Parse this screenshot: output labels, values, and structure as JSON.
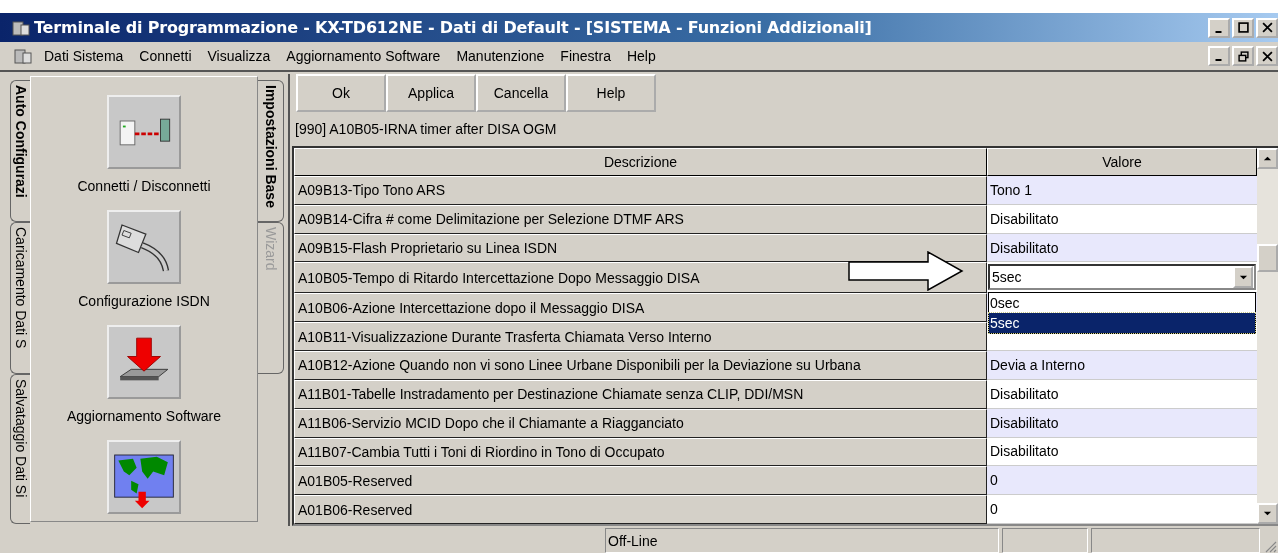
{
  "window": {
    "title": "Terminale di Programmazione - KX-TD612NE - Dati di Default - [SISTEMA - Funzioni Addizionali]"
  },
  "menu": [
    "Dati Sistema",
    "Connetti",
    "Visualizza",
    "Aggiornamento Software",
    "Manutenzione",
    "Finestra",
    "Help"
  ],
  "side_tabs": [
    {
      "label": "Auto Configurazi",
      "selected": true
    },
    {
      "label": "Caricamento Dati S",
      "selected": false
    },
    {
      "label": "Salvataggio Dati Si",
      "selected": false
    }
  ],
  "launcher": [
    {
      "kind": "connect",
      "label": "Connetti / Disconnetti"
    },
    {
      "kind": "isdn",
      "label": "Configurazione ISDN"
    },
    {
      "kind": "upgrade",
      "label": "Aggiornamento Software"
    },
    {
      "kind": "map"
    }
  ],
  "panel_tabs": [
    {
      "label": "Impostazioni Base",
      "selected": true,
      "disabled": false
    },
    {
      "label": "Wizard",
      "selected": false,
      "disabled": true
    }
  ],
  "buttons": [
    "Ok",
    "Applica",
    "Cancella",
    "Help"
  ],
  "info": "[990] A10B05-IRNA timer after DISA OGM",
  "table": {
    "columns": [
      "Descrizione",
      "Valore"
    ],
    "rows": [
      {
        "kind": "text",
        "description": "A09B13-Tipo Tono ARS",
        "value": "Tono 1"
      },
      {
        "kind": "text",
        "description": "A09B14-Cifra # come Delimitazione per Selezione DTMF ARS",
        "value": "Disabilitato"
      },
      {
        "kind": "text",
        "description": "A09B15-Flash Proprietario su Linea ISDN",
        "value": "Disabilitato"
      },
      {
        "kind": "dropdown",
        "description": "A10B05-Tempo di Ritardo Intercettazione Dopo Messaggio DISA",
        "value": "5sec",
        "options": [
          {
            "label": "0sec",
            "selected": false
          },
          {
            "label": "5sec",
            "selected": true
          }
        ]
      },
      {
        "kind": "text",
        "description": "A10B06-Azione Intercettazione dopo il Messaggio DISA"
      },
      {
        "kind": "text",
        "description": "A10B11-Visualizzazione Durante Trasferta Chiamata Verso Interno"
      },
      {
        "kind": "text",
        "description": "A10B12-Azione Quando non vi sono Linee Urbane Disponibili per la Deviazione su Urbana",
        "value": "Devia a Interno"
      },
      {
        "kind": "text",
        "description": "A11B01-Tabelle Instradamento per Destinazione Chiamate senza CLIP, DDI/MSN",
        "value": "Disabilitato"
      },
      {
        "kind": "text",
        "description": "A11B06-Servizio MCID Dopo che il Chiamante a Riagganciato",
        "value": "Disabilitato"
      },
      {
        "kind": "text",
        "description": "A11B07-Cambia Tutti i Toni di Riordino in Tono di Occupato",
        "value": "Disabilitato"
      },
      {
        "kind": "text",
        "description": "A01B05-Reserved",
        "value": "0"
      },
      {
        "kind": "text",
        "description": "A01B06-Reserved",
        "value": "0"
      }
    ]
  },
  "status_bar": {
    "text": "Off-Line"
  }
}
